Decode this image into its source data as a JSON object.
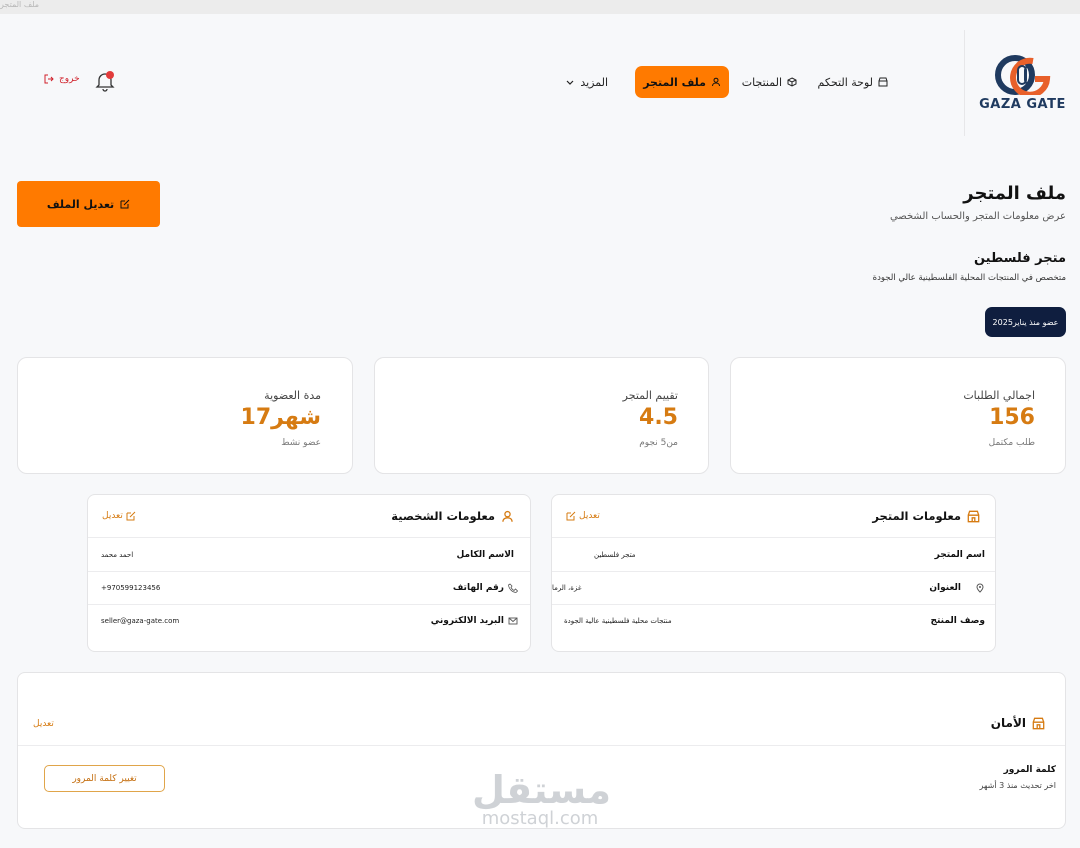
{
  "browser": {
    "tab_title": "ملف المتجر"
  },
  "brand": {
    "name": "GAZA GATE",
    "accent": "#ff7a00",
    "navy": "#1f3a5f"
  },
  "nav": {
    "dashboard": "لوحة التحكم",
    "products": "المنتجات",
    "profile": "ملف المتجر",
    "more": "المزيد",
    "logout": "خروج"
  },
  "page": {
    "title": "ملف المتجر",
    "subtitle": "عرض معلومات المتجر والحساب الشخصي",
    "edit_button": "تعديل الملف",
    "store_name": "متجر فلسطين",
    "store_desc": "متخصص في المنتجات المحلية الفلسطينية عالي الجودة",
    "member_since": "عضو منذ يناير2025"
  },
  "stats": [
    {
      "label": "اجمالي الطلبات",
      "value": "156",
      "note": "طلب مكتمل"
    },
    {
      "label": "تقييم المتجر",
      "value": "4.5",
      "note": "من5 نجوم"
    },
    {
      "label": "مدة العضوية",
      "value": "17شهر",
      "note": "عضو نشط"
    }
  ],
  "store_info": {
    "title": "معلومات المتجر",
    "edit": "تعديل",
    "rows": [
      {
        "key": "اسم المتجر",
        "value": "متجر فلسطين"
      },
      {
        "key": "العنوان",
        "value": "غزة، الرما"
      },
      {
        "key": "وصف المنتج",
        "value": "منتجات محلية فلسطينية عالية الجودة"
      }
    ]
  },
  "personal_info": {
    "title": "معلومات الشخصية",
    "edit": "تعديل",
    "rows": [
      {
        "key": "الاسم الكامل",
        "value": "احمد محمد"
      },
      {
        "key": "رقم الهاتف",
        "value": "+970599123456"
      },
      {
        "key": "البريد الالكتروني",
        "value": "seller@gaza-gate.com"
      }
    ]
  },
  "security": {
    "title": "الأمان",
    "edit": "تعديل",
    "password_label": "كلمة المرور",
    "password_note": "اخر تحديث منذ 3 أشهر",
    "change_button": "تغيير كلمة المرور"
  },
  "watermark": {
    "ar": "مستقل",
    "en": "mostaql.com"
  }
}
